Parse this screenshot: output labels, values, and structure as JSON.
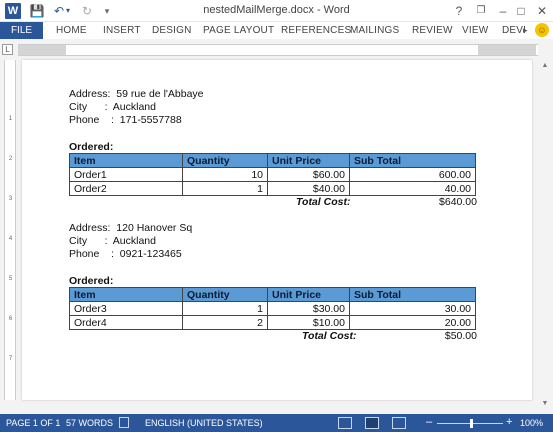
{
  "titlebar": {
    "app_icon": "W",
    "title": "nestedMailMerge.docx - Word",
    "help": "?",
    "restore": "❐",
    "minimize": "–",
    "maximize": "□",
    "close": "✕"
  },
  "quick_access": {
    "save": "💾",
    "undo": "↶",
    "undo_dropdown": "▾",
    "redo": "↻",
    "customize": "▾"
  },
  "tabs": {
    "file": "FILE",
    "items": [
      "HOME",
      "INSERT",
      "DESIGN",
      "PAGE LAYOUT",
      "REFERENCES",
      "MAILINGS",
      "REVIEW",
      "VIEW",
      "DEVI"
    ],
    "more": "▸",
    "smile": "☺"
  },
  "ruler": {
    "corner": "L"
  },
  "records": [
    {
      "address_label": "Address:",
      "address": "59 rue de l'Abbaye",
      "city_label": "City",
      "city": "Auckland",
      "phone_label": "Phone",
      "phone": "171-5557788",
      "ordered_label": "Ordered:",
      "headers": [
        "Item",
        "Quantity",
        "Unit Price",
        "Sub Total"
      ],
      "rows": [
        [
          "Order1",
          "10",
          "$60.00",
          "600.00"
        ],
        [
          "Order2",
          "1",
          "$40.00",
          "40.00"
        ]
      ],
      "total_label": "Total Cost:",
      "total": "$640.00"
    },
    {
      "address_label": "Address:",
      "address": "120 Hanover Sq",
      "city_label": "City",
      "city": "Auckland",
      "phone_label": "Phone",
      "phone": "0921-123465",
      "ordered_label": "Ordered:",
      "headers": [
        "Item",
        "Quantity",
        "Unit Price",
        "Sub Total"
      ],
      "rows": [
        [
          "Order3",
          "1",
          "$30.00",
          "30.00"
        ],
        [
          "Order4",
          "2",
          "$10.00",
          "20.00"
        ]
      ],
      "total_label": "Total Cost:",
      "total": "$50.00"
    }
  ],
  "status": {
    "page": "PAGE 1 OF 1",
    "words": "57 WORDS",
    "language": "ENGLISH (UNITED STATES)",
    "zoom_out": "–",
    "zoom_in": "+",
    "zoom": "100%"
  },
  "colors": {
    "accent": "#2b579a",
    "table_header": "#5b9bd5"
  }
}
